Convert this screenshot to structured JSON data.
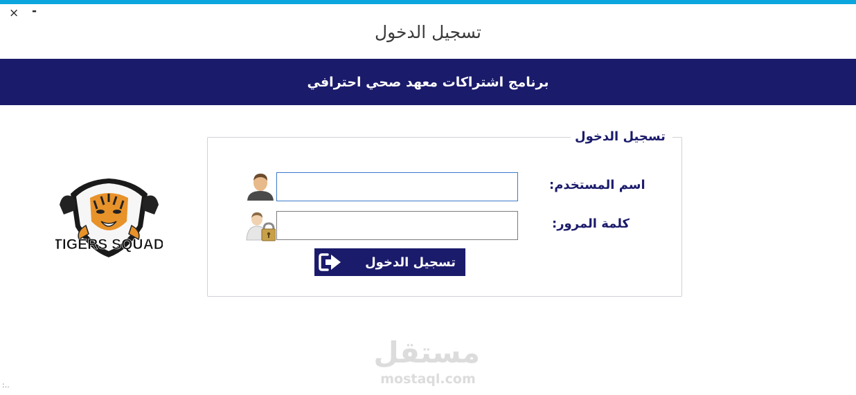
{
  "window": {
    "title": "تسجيل الدخول",
    "close_glyph": "×",
    "minimize_glyph": "-",
    "accent_color": "#0aa6dd"
  },
  "banner": {
    "text": "برنامج اشتراكات معهد صحي احترافي",
    "color": "#1b1b6c"
  },
  "logo": {
    "text": "TIGERS SQUAD",
    "icon": "tiger-emblem"
  },
  "login_group": {
    "legend": "تسجيل الدخول",
    "username_label": "اسم المستخدم:",
    "username_value": "",
    "username_icon": "user-icon",
    "password_label": "كلمة المرور:",
    "password_value": "",
    "password_icon": "user-lock-icon",
    "submit_label": "تسجيل الدخول",
    "submit_icon": "sign-in-arrow-icon"
  },
  "watermark": {
    "arabic": "مستقل",
    "latin": "mostaql.com"
  },
  "resize_grip": ":.."
}
